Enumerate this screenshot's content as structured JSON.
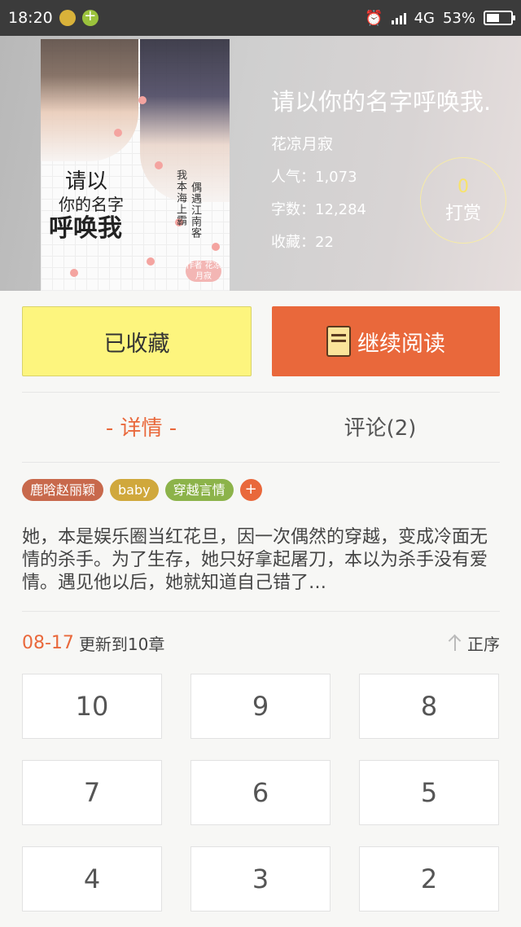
{
  "status_bar": {
    "time": "18:20",
    "network": "4G",
    "battery": "53%",
    "battery_level": 0.53
  },
  "book": {
    "title": "请以你的名字呼唤我.",
    "author": "花凉月寂",
    "popularity": "人气：1,073",
    "word_count": "字数：12,284",
    "favorites": "收藏：22"
  },
  "cover": {
    "line1": "请以",
    "line2": "你的名字",
    "line3": "呼唤我",
    "vertical_a": "我本海上霸",
    "vertical_b": "偶遇江南客",
    "stamp": "作者 花凉月寂"
  },
  "reward": {
    "count": "0",
    "label": "打赏"
  },
  "actions": {
    "favorited_label": "已收藏",
    "continue_label": "继续阅读"
  },
  "tabs": {
    "detail": "- 详情 -",
    "comments": "评论(2)"
  },
  "tags": [
    {
      "label": "鹿晗赵丽颖",
      "color": "#c8694c"
    },
    {
      "label": "baby",
      "color": "#d0a83c"
    },
    {
      "label": "穿越言情",
      "color": "#8cb34a"
    }
  ],
  "tag_add": "+",
  "synopsis": "她，本是娱乐圈当红花旦，因一次偶然的穿越，变成冷面无情的杀手。为了生存，她只好拿起屠刀，本以为杀手没有爱情。遇见他以后，她就知道自己错了…",
  "update": {
    "date": "08-17",
    "text": "更新到10章",
    "sort_label": "正序"
  },
  "chapters": [
    "10",
    "9",
    "8",
    "7",
    "6",
    "5",
    "4",
    "3",
    "2"
  ],
  "colors": {
    "accent": "#e9683b",
    "favorite_bg": "#fdf57e",
    "reward": "#f8e36a"
  }
}
